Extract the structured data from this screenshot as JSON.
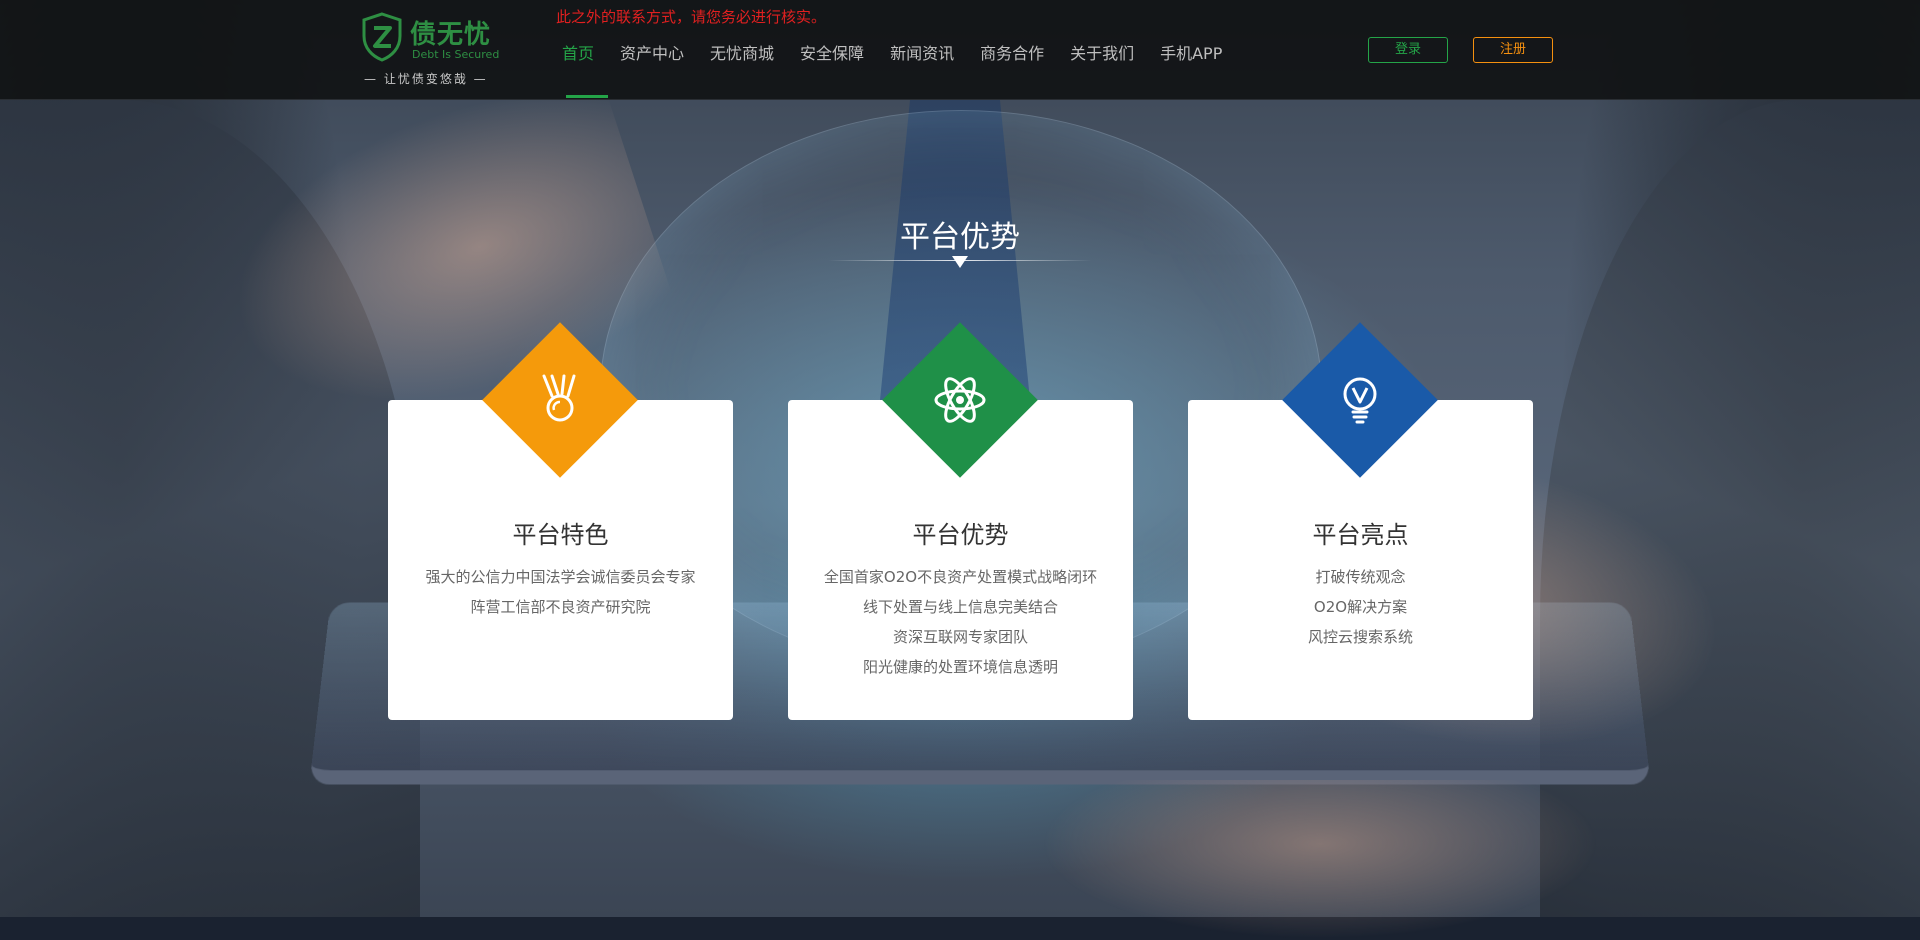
{
  "header": {
    "logo": {
      "name": "债无忧",
      "tagline_en": "Debt Is Secured",
      "slogan": "— 让忧债变悠哉 —"
    },
    "notice": "此之外的联系方式，请您务必进行核实。",
    "nav": [
      {
        "label": "首页",
        "active": true
      },
      {
        "label": "资产中心",
        "active": false
      },
      {
        "label": "无忧商城",
        "active": false
      },
      {
        "label": "安全保障",
        "active": false
      },
      {
        "label": "新闻资讯",
        "active": false
      },
      {
        "label": "商务合作",
        "active": false
      },
      {
        "label": "关于我们",
        "active": false
      },
      {
        "label": "手机APP",
        "active": false
      }
    ],
    "login_label": "登录",
    "register_label": "注册"
  },
  "section": {
    "title": "平台优势"
  },
  "cards": [
    {
      "icon": "medal-icon",
      "color": "#f59a0b",
      "title": "平台特色",
      "lines": [
        "强大的公信力中国法学会诚信委员会专家",
        "阵营工信部不良资产研究院"
      ]
    },
    {
      "icon": "atom-icon",
      "color": "#1f9048",
      "title": "平台优势",
      "lines": [
        "全国首家O2O不良资产处置模式战略闭环",
        "线下处置与线上信息完美结合",
        "资深互联网专家团队",
        "阳光健康的处置环境信息透明"
      ]
    },
    {
      "icon": "lightbulb-icon",
      "color": "#1a5aa8",
      "title": "平台亮点",
      "lines": [
        "打破传统观念",
        "O2O解决方案",
        "风控云搜索系统"
      ]
    }
  ],
  "colors": {
    "brand_green": "#24a448",
    "accent_orange": "#f5900f",
    "notice_red": "#e02020"
  }
}
